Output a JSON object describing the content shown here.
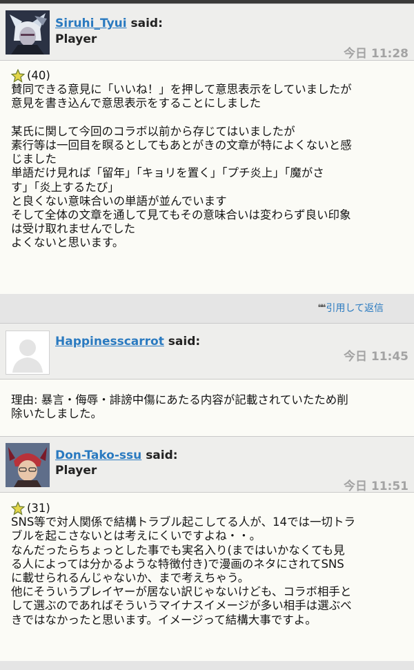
{
  "posts": [
    {
      "author": "Siruhi_Tyui",
      "said": "said:",
      "role": "Player",
      "time": "今日 11:28",
      "rating": "(40)",
      "lines": [
        "賛同できる意見に「いいね！」を押して意思表示をしていましたが",
        "意見を書き込んで意思表示をすることにしました",
        "",
        "某氏に関して今回のコラボ以前から存じてはいましたが",
        "素行等は一回目を瞑るとしてもあとがきの文章が特によくないと感",
        "じました",
        "単語だけ見れば「留年」「キョリを置く」「プチ炎上」「魔がさ",
        "す」「炎上するたび」",
        "と良くない意味合いの単語が並んでいます",
        "そして全体の文章を通して見てもその意味合いは変わらず良い印象",
        "は受け取れませんでした",
        "よくないと思います。"
      ],
      "reply_label": "引用して返信"
    },
    {
      "author": "Happinesscarrot",
      "said": "said:",
      "time": "今日 11:45",
      "lines": [
        "理由: 暴言・侮辱・誹謗中傷にあたる内容が記載されていたため削",
        "除いたしました。"
      ]
    },
    {
      "author": "Don-Tako-ssu",
      "said": "said:",
      "role": "Player",
      "time": "今日 11:51",
      "rating": "(31)",
      "lines": [
        "SNS等で対人関係で結構トラブル起こしてる人が、14では一切トラ",
        "ブルを起こさないとは考えにくいですよね・・。",
        "なんだったらちょっとした事でも実名入り(まではいかなくても見",
        "る人によっては分かるような特徴付き)で漫画のネタにされてSNS",
        "に載せられるんじゃないか、まで考えちゃう。",
        "他にそういうプレイヤーが居ない訳じゃないけども、コラボ相手と",
        "して選ぶのであればそういうマイナスイメージが多い相手は選ぶべ",
        "きではなかったと思います。イメージって結構大事ですよ。"
      ]
    }
  ],
  "colors": {
    "link": "#2a7ac0",
    "timestamp": "#a3a3a3",
    "header_bg": "#eeeeec",
    "body_bg": "#fbfbf6",
    "reply_bg": "#e5e5e5"
  },
  "icons": {
    "rating": "star-icon",
    "reply": "quote-icon"
  }
}
